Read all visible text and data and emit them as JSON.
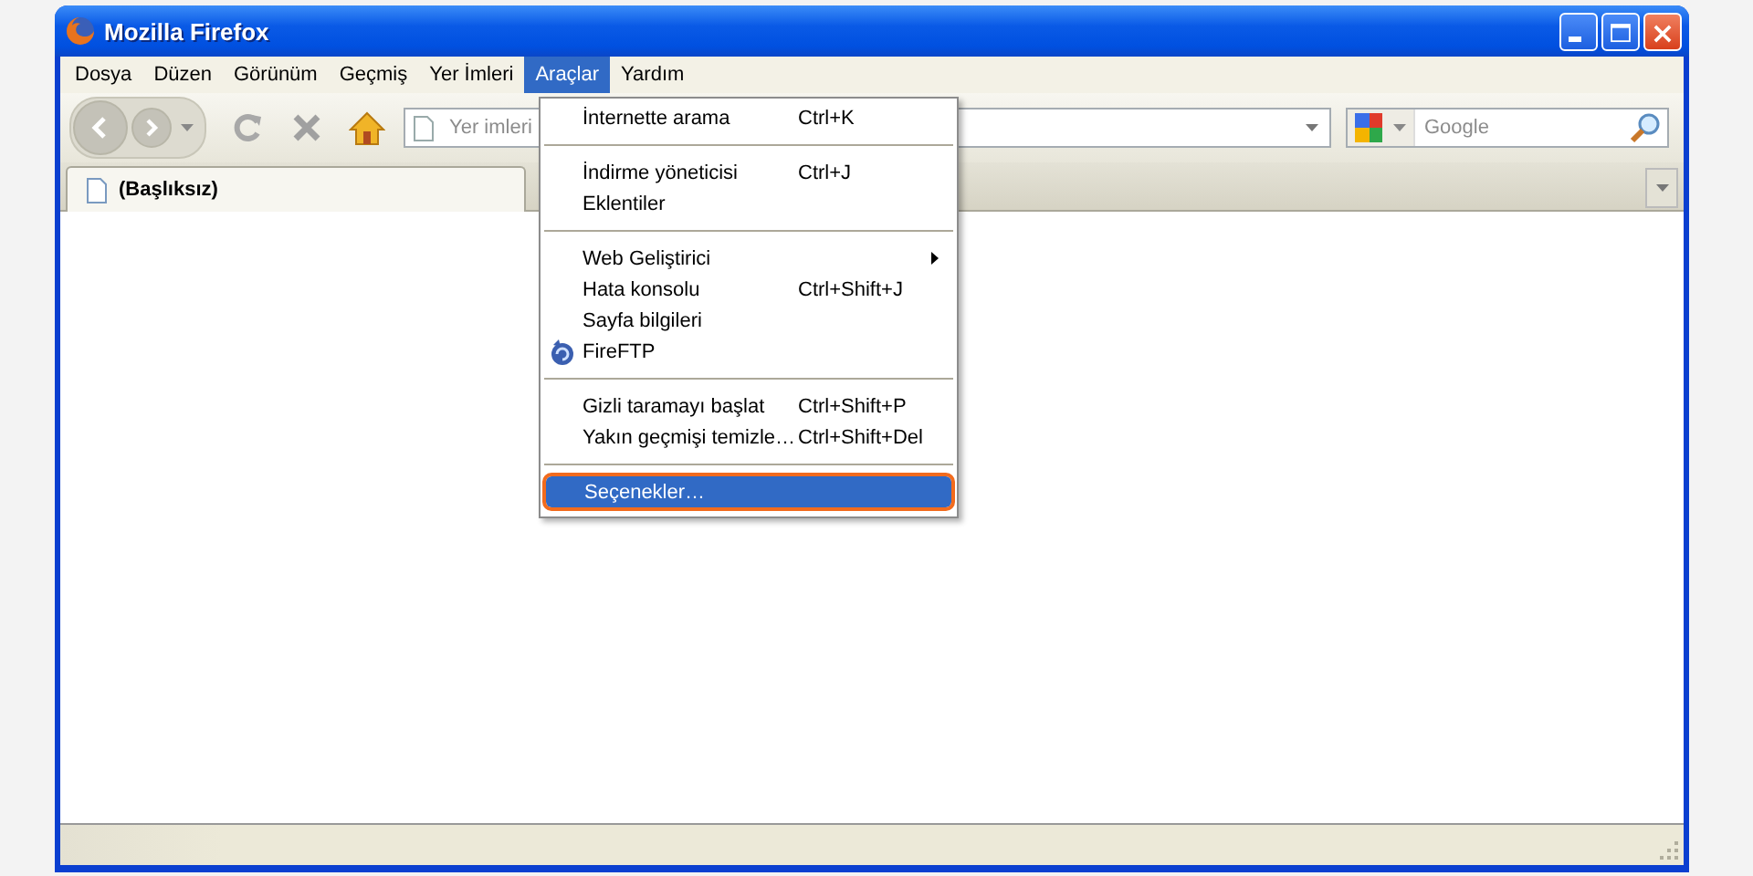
{
  "window": {
    "title": "Mozilla Firefox"
  },
  "menu_bar": [
    {
      "label": "Dosya",
      "selected": false
    },
    {
      "label": "Düzen",
      "selected": false
    },
    {
      "label": "Görünüm",
      "selected": false
    },
    {
      "label": "Geçmiş",
      "selected": false
    },
    {
      "label": "Yer İmleri",
      "selected": false
    },
    {
      "label": "Araçlar",
      "selected": true
    },
    {
      "label": "Yardım",
      "selected": false
    }
  ],
  "toolbar": {
    "address_bar": {
      "placeholder": "Yer imleri"
    },
    "search_bar": {
      "placeholder": "Google"
    }
  },
  "tabs": [
    {
      "label": "(Başlıksız)",
      "selected": true
    }
  ],
  "dropdown_menu": {
    "groups": [
      [
        {
          "label": "İnternette arama",
          "shortcut": "Ctrl+K",
          "icon": false,
          "submenu": false,
          "selected": false
        }
      ],
      [
        {
          "label": "İndirme yöneticisi",
          "shortcut": "Ctrl+J",
          "icon": false,
          "submenu": false,
          "selected": false
        },
        {
          "label": "Eklentiler",
          "icon": false,
          "submenu": false,
          "selected": false
        }
      ],
      [
        {
          "label": "Web Geliştirici",
          "icon": false,
          "submenu": true,
          "selected": false
        },
        {
          "label": "Hata konsolu",
          "shortcut": "Ctrl+Shift+J",
          "icon": false,
          "submenu": false,
          "selected": false
        },
        {
          "label": "Sayfa bilgileri",
          "icon": false,
          "submenu": false,
          "selected": false
        },
        {
          "label": "FireFTP",
          "icon": true,
          "submenu": false,
          "selected": false
        }
      ],
      [
        {
          "label": "Gizli taramayı başlat",
          "shortcut": "Ctrl+Shift+P",
          "icon": false,
          "submenu": false,
          "selected": false
        },
        {
          "label": "Yakın geçmişi temizle…",
          "shortcut": "Ctrl+Shift+Del",
          "icon": false,
          "submenu": false,
          "selected": false
        }
      ],
      [
        {
          "label": "Seçenekler…",
          "icon": false,
          "submenu": false,
          "selected": true
        }
      ]
    ]
  }
}
